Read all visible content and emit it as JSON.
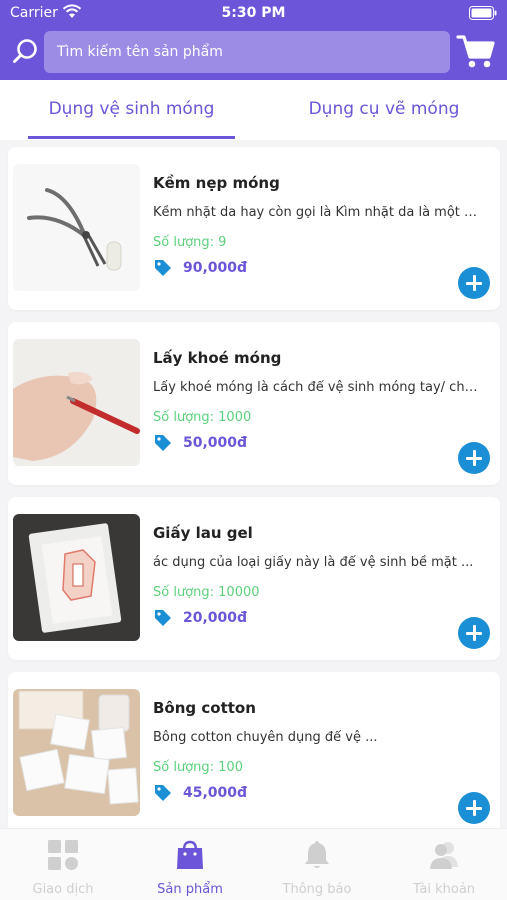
{
  "status": {
    "carrier": "Carrier",
    "time": "5:30 PM"
  },
  "search": {
    "placeholder": "Tìm kiếm tên sản phẩm"
  },
  "tabs": [
    {
      "label": "Dụng vệ sinh móng",
      "active": true
    },
    {
      "label": "Dụng cụ vẽ móng",
      "active": false
    }
  ],
  "products": [
    {
      "name": "Kềm nẹp móng",
      "description": "Kềm nhặt da hay còn gọi là Kìm nhặt da là một d...",
      "quantity": "Số lượng: 9",
      "price": "90,000đ"
    },
    {
      "name": "Lấy khoé móng",
      "description": "Lấy khoé móng là cách để vệ sinh móng tay/ chân...",
      "quantity": "Số lượng: 1000",
      "price": "50,000đ"
    },
    {
      "name": "Giấy lau gel",
      "description": "ác dụng của loại giấy này là để vệ sinh bề mặt ...",
      "quantity": "Số lượng: 10000",
      "price": "20,000đ"
    },
    {
      "name": "Bông cotton",
      "description": "Bông cotton chuyên dụng để vệ ...",
      "quantity": "Số lượng: 100",
      "price": "45,000đ"
    }
  ],
  "nav": [
    {
      "label": "Giao dịch",
      "icon": "grid-icon",
      "active": false
    },
    {
      "label": "Sản phẩm",
      "icon": "shopping-bag-icon",
      "active": true
    },
    {
      "label": "Thông báo",
      "icon": "bell-icon",
      "active": false
    },
    {
      "label": "Tài khoản",
      "icon": "users-icon",
      "active": false
    }
  ],
  "colors": {
    "primary": "#6c55d8",
    "accent_button": "#1b8fd6",
    "quantity_text": "#5cd07c"
  }
}
